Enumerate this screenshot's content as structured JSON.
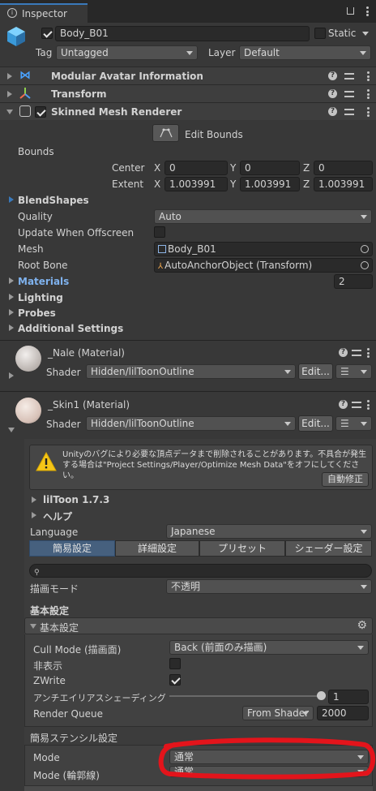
{
  "window": {
    "tab_title": "Inspector"
  },
  "object": {
    "name": "Body_B01",
    "static_label": "Static",
    "tag_label": "Tag",
    "tag_value": "Untagged",
    "layer_label": "Layer",
    "layer_value": "Default"
  },
  "components": {
    "modular_avatar": "Modular Avatar Information",
    "transform": "Transform",
    "smr": "Skinned Mesh Renderer"
  },
  "smr": {
    "edit_bounds": "Edit Bounds",
    "bounds_label": "Bounds",
    "center_label": "Center",
    "extent_label": "Extent",
    "x": "X",
    "y": "Y",
    "z": "Z",
    "center": {
      "x": "0",
      "y": "0",
      "z": "0"
    },
    "extent": {
      "x": "1.003991",
      "y": "1.003991",
      "z": "1.003991"
    },
    "blendshapes": "BlendShapes",
    "quality_label": "Quality",
    "quality_value": "Auto",
    "update_offscreen_label": "Update When Offscreen",
    "mesh_label": "Mesh",
    "mesh_value": "Body_B01",
    "root_bone_label": "Root Bone",
    "root_bone_value": "AutoAnchorObject (Transform)",
    "materials_label": "Materials",
    "materials_count": "2",
    "lighting": "Lighting",
    "probes": "Probes",
    "additional": "Additional Settings"
  },
  "materials": [
    {
      "name": "_Nale (Material)",
      "shader_label": "Shader",
      "shader_value": "Hidden/lilToonOutline",
      "edit_label": "Edit..."
    },
    {
      "name": "_Skin1 (Material)",
      "shader_label": "Shader",
      "shader_value": "Hidden/lilToonOutline",
      "edit_label": "Edit..."
    }
  ],
  "liltoon": {
    "warning_text": "Unityのバグにより必要な頂点データまで削除されることがあります。不具合が発生する場合は\"Project Settings/Player/Optimize Mesh Data\"をオフにしてください。",
    "auto_fix": "自動修正",
    "version": "lilToon 1.7.3",
    "help": "ヘルプ",
    "language_label": "Language",
    "language_value": "Japanese",
    "tabs": [
      "簡易設定",
      "詳細設定",
      "プリセット",
      "シェーダー設定"
    ],
    "render_mode_label": "描画モード",
    "render_mode_value": "不透明",
    "basic_header": "基本設定",
    "basic_foldout": "基本設定",
    "cull_label": "Cull Mode (描画面)",
    "cull_value": "Back (前面のみ描画)",
    "hide_label": "非表示",
    "zwrite_label": "ZWrite",
    "aa_label": "アンチエイリアスシェーディング",
    "aa_value": "1",
    "rq_label": "Render Queue",
    "rq_mode": "From Shader",
    "rq_value": "2000",
    "stencil_header": "簡易ステンシル設定",
    "mode_label": "Mode",
    "mode_value": "通常",
    "mode_outline_label": "Mode (輪郭線)",
    "mode_outline_value": "通常"
  }
}
